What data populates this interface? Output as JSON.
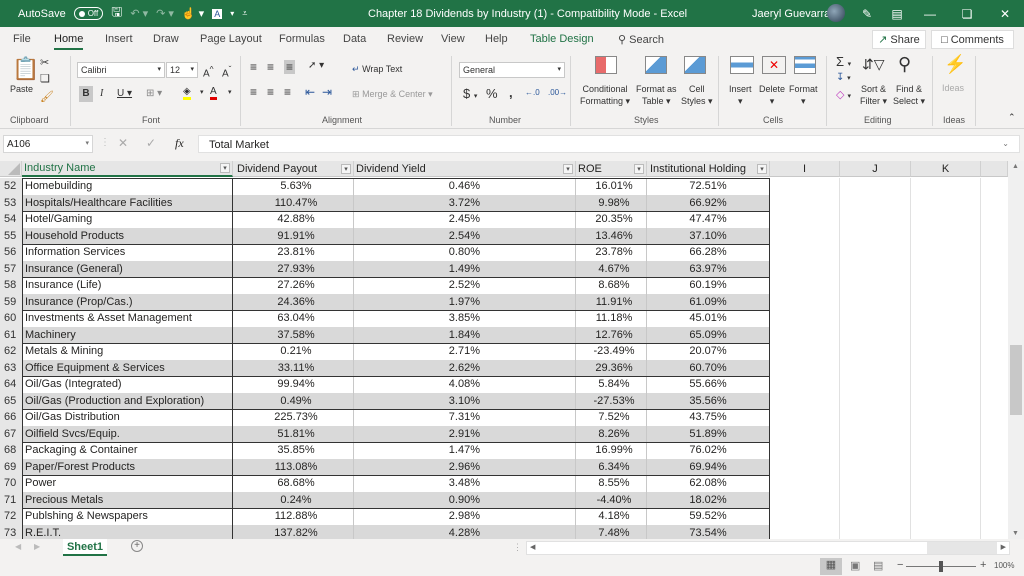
{
  "titlebar": {
    "autosave_label": "AutoSave",
    "autosave_state": "Off",
    "title": "Chapter 18 Dividends by Industry (1)  -  Compatibility Mode  -  Excel",
    "user": "Jaeryl Guevarra"
  },
  "tabs": [
    "File",
    "Home",
    "Insert",
    "Draw",
    "Page Layout",
    "Formulas",
    "Data",
    "Review",
    "View",
    "Help",
    "Table Design"
  ],
  "search_label": "Search",
  "share_label": "Share",
  "comments_label": "Comments",
  "ribbon": {
    "clipboard": {
      "paste": "Paste",
      "label": "Clipboard"
    },
    "font": {
      "name": "Calibri",
      "size": "12",
      "label": "Font"
    },
    "alignment": {
      "wrap": "Wrap Text",
      "merge": "Merge & Center",
      "label": "Alignment"
    },
    "number": {
      "format": "General",
      "label": "Number"
    },
    "styles": {
      "conditional": "Conditional",
      "conditional2": "Formatting",
      "format_as": "Format as",
      "format_as2": "Table",
      "cell": "Cell",
      "cell2": "Styles",
      "label": "Styles"
    },
    "cells": {
      "insert": "Insert",
      "delete": "Delete",
      "format": "Format",
      "label": "Cells"
    },
    "editing": {
      "sort": "Sort &",
      "sort2": "Filter",
      "find": "Find &",
      "find2": "Select",
      "label": "Editing"
    },
    "ideas": {
      "btn": "Ideas",
      "label": "Ideas"
    }
  },
  "formula_bar": {
    "name_box": "A106",
    "fx": "fx",
    "value": "Total Market"
  },
  "columns": {
    "name": "Industry Name",
    "payout": "Dividend Payout",
    "yield": "Dividend Yield",
    "roe": "ROE",
    "inst": "Institutional Holding",
    "i": "I",
    "j": "J",
    "k": "K"
  },
  "rows": [
    {
      "n": "52",
      "name": "Homebuilding",
      "payout": "5.63%",
      "yield": "0.46%",
      "roe": "16.01%",
      "inst": "72.51%"
    },
    {
      "n": "53",
      "name": "Hospitals/Healthcare Facilities",
      "payout": "110.47%",
      "yield": "3.72%",
      "roe": "9.98%",
      "inst": "66.92%"
    },
    {
      "n": "54",
      "name": "Hotel/Gaming",
      "payout": "42.88%",
      "yield": "2.45%",
      "roe": "20.35%",
      "inst": "47.47%"
    },
    {
      "n": "55",
      "name": "Household Products",
      "payout": "91.91%",
      "yield": "2.54%",
      "roe": "13.46%",
      "inst": "37.10%"
    },
    {
      "n": "56",
      "name": "Information Services",
      "payout": "23.81%",
      "yield": "0.80%",
      "roe": "23.78%",
      "inst": "66.28%"
    },
    {
      "n": "57",
      "name": "Insurance (General)",
      "payout": "27.93%",
      "yield": "1.49%",
      "roe": "4.67%",
      "inst": "63.97%"
    },
    {
      "n": "58",
      "name": "Insurance (Life)",
      "payout": "27.26%",
      "yield": "2.52%",
      "roe": "8.68%",
      "inst": "60.19%"
    },
    {
      "n": "59",
      "name": "Insurance (Prop/Cas.)",
      "payout": "24.36%",
      "yield": "1.97%",
      "roe": "11.91%",
      "inst": "61.09%"
    },
    {
      "n": "60",
      "name": "Investments & Asset Management",
      "payout": "63.04%",
      "yield": "3.85%",
      "roe": "11.18%",
      "inst": "45.01%"
    },
    {
      "n": "61",
      "name": "Machinery",
      "payout": "37.58%",
      "yield": "1.84%",
      "roe": "12.76%",
      "inst": "65.09%"
    },
    {
      "n": "62",
      "name": "Metals & Mining",
      "payout": "0.21%",
      "yield": "2.71%",
      "roe": "-23.49%",
      "inst": "20.07%"
    },
    {
      "n": "63",
      "name": "Office Equipment & Services",
      "payout": "33.11%",
      "yield": "2.62%",
      "roe": "29.36%",
      "inst": "60.70%"
    },
    {
      "n": "64",
      "name": "Oil/Gas (Integrated)",
      "payout": "99.94%",
      "yield": "4.08%",
      "roe": "5.84%",
      "inst": "55.66%"
    },
    {
      "n": "65",
      "name": "Oil/Gas (Production and Exploration)",
      "payout": "0.49%",
      "yield": "3.10%",
      "roe": "-27.53%",
      "inst": "35.56%"
    },
    {
      "n": "66",
      "name": "Oil/Gas Distribution",
      "payout": "225.73%",
      "yield": "7.31%",
      "roe": "7.52%",
      "inst": "43.75%"
    },
    {
      "n": "67",
      "name": "Oilfield Svcs/Equip.",
      "payout": "51.81%",
      "yield": "2.91%",
      "roe": "8.26%",
      "inst": "51.89%"
    },
    {
      "n": "68",
      "name": "Packaging & Container",
      "payout": "35.85%",
      "yield": "1.47%",
      "roe": "16.99%",
      "inst": "76.02%"
    },
    {
      "n": "69",
      "name": "Paper/Forest Products",
      "payout": "113.08%",
      "yield": "2.96%",
      "roe": "6.34%",
      "inst": "69.94%"
    },
    {
      "n": "70",
      "name": "Power",
      "payout": "68.68%",
      "yield": "3.48%",
      "roe": "8.55%",
      "inst": "62.08%"
    },
    {
      "n": "71",
      "name": "Precious Metals",
      "payout": "0.24%",
      "yield": "0.90%",
      "roe": "-4.40%",
      "inst": "18.02%"
    },
    {
      "n": "72",
      "name": "Publshing & Newspapers",
      "payout": "112.88%",
      "yield": "2.98%",
      "roe": "4.18%",
      "inst": "59.52%"
    },
    {
      "n": "73",
      "name": "R.E.I.T.",
      "payout": "137.82%",
      "yield": "4.28%",
      "roe": "7.48%",
      "inst": "73.54%"
    }
  ],
  "sheet_tab": "Sheet1",
  "zoom": "100%",
  "colors": {
    "brand": "#217346",
    "band": "#d9d9d9"
  }
}
